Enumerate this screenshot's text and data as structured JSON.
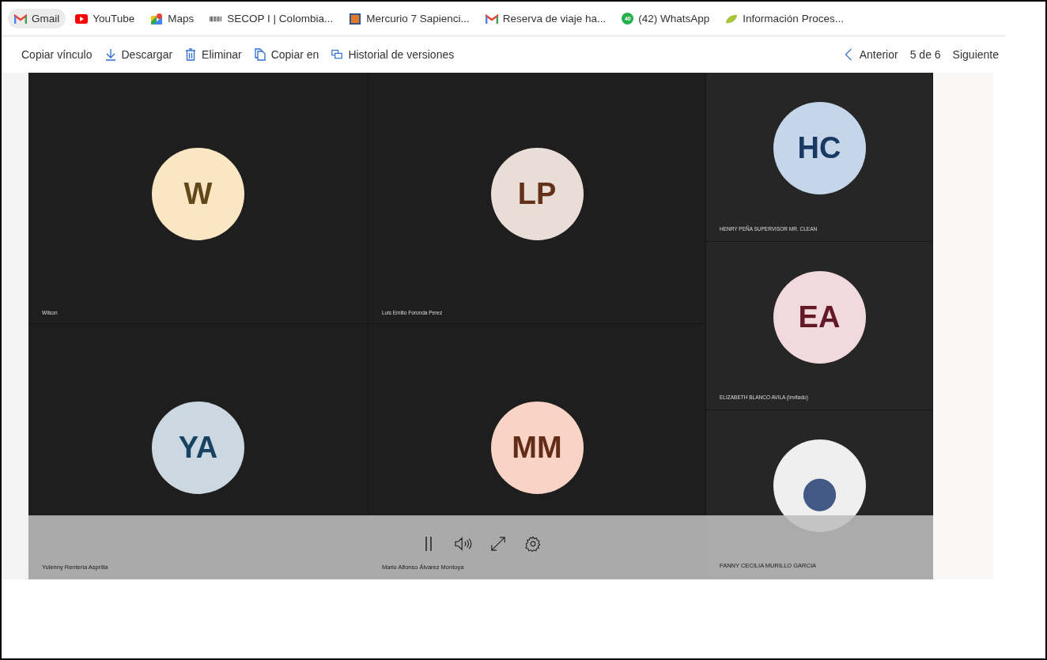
{
  "bookmarks": [
    {
      "label": "Gmail",
      "kind": "gmail",
      "selected": true
    },
    {
      "label": "YouTube",
      "kind": "youtube",
      "selected": false
    },
    {
      "label": "Maps",
      "kind": "maps",
      "selected": false
    },
    {
      "label": "SECOP I | Colombia...",
      "kind": "barcode",
      "selected": false
    },
    {
      "label": "Mercurio 7 Sapienci...",
      "kind": "square",
      "selected": false
    },
    {
      "label": "Reserva de viaje ha...",
      "kind": "gmail",
      "selected": false
    },
    {
      "label": "(42) WhatsApp",
      "kind": "whatsapp",
      "badge": "40",
      "selected": false
    },
    {
      "label": "Información Proces...",
      "kind": "leaf",
      "selected": false
    }
  ],
  "toolbar": [
    {
      "label": "Copiar vínculo",
      "kind": "none"
    },
    {
      "label": "Descargar",
      "kind": "download"
    },
    {
      "label": "Eliminar",
      "kind": "trash"
    },
    {
      "label": "Copiar en",
      "kind": "copy"
    },
    {
      "label": "Historial de versiones",
      "kind": "history"
    }
  ],
  "pager": {
    "previous": "Anterior",
    "position": "5 de 6",
    "next": "Siguiente"
  },
  "grid_tiles": [
    {
      "initials": "W",
      "name": "Wilson",
      "kind": "initials",
      "color": "#fbe6c3"
    },
    {
      "initials": "LP",
      "name": "Luis Emilio Foronda Perez",
      "kind": "initials",
      "color": "#e9ddd7"
    },
    {
      "initials": "YA",
      "name": "Yulenny Renteria Asprilla",
      "kind": "initials",
      "color": "#ccd8e1"
    },
    {
      "initials": "MM",
      "name": "Mario Alfonso Álvarez Montoya",
      "kind": "initials",
      "color": "#f9d4c6"
    }
  ],
  "side_tiles": [
    {
      "initials": "HC",
      "name": "HENRY PEÑA SUPERVISOR MR. CLEAN",
      "kind": "initials",
      "color": "#c6d6ea"
    },
    {
      "initials": "EA",
      "name": "ELIZABETH BLANCO AVILA (Invitado)",
      "kind": "initials",
      "color": "#f1d9dd"
    },
    {
      "name": "FANNY CECILIA MURILLO GARCIA",
      "kind": "photo"
    }
  ],
  "player": {
    "playing": true
  }
}
